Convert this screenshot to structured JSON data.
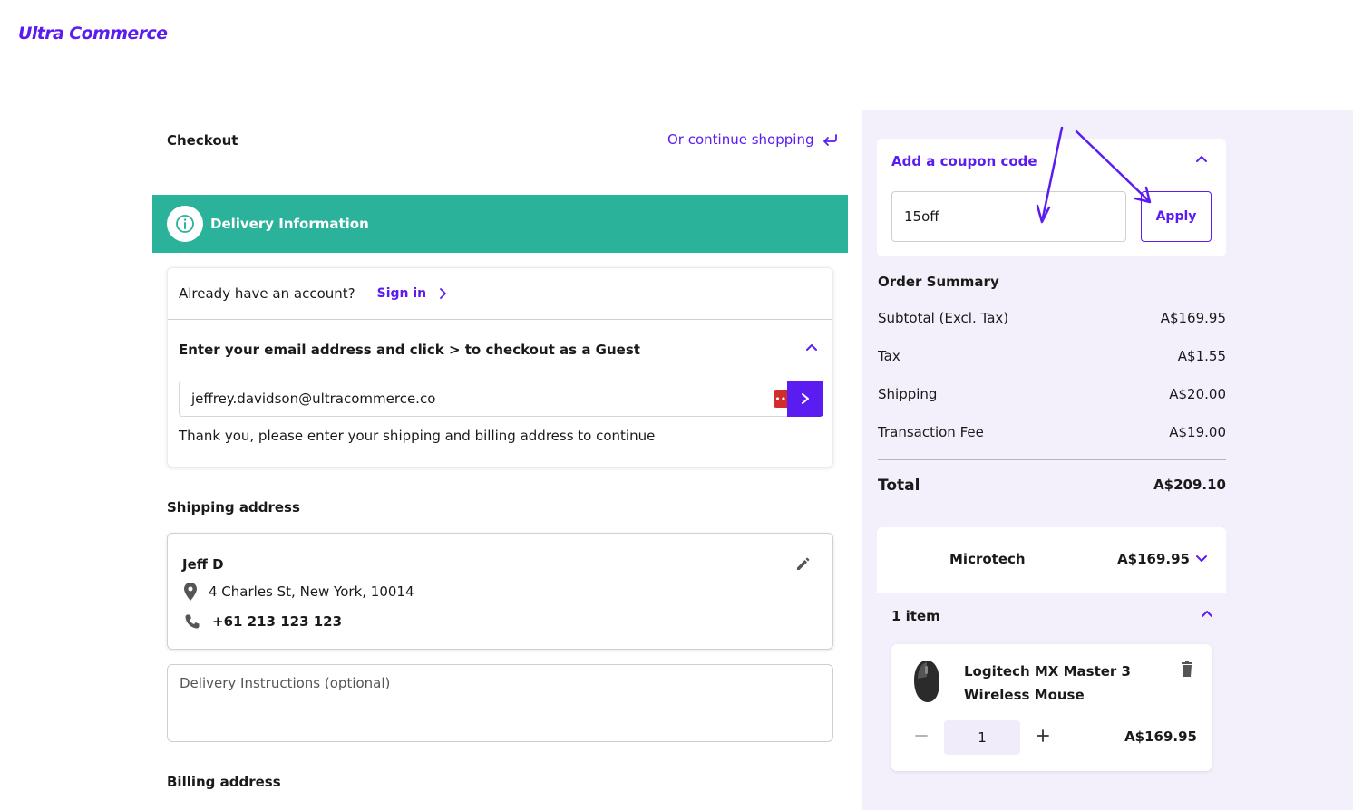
{
  "brand": {
    "logo": "Ultra Commerce",
    "accent": "#5b1cf2",
    "banner_color": "#2bb29b"
  },
  "header": {
    "title": "Checkout",
    "continue_link": "Or continue shopping"
  },
  "delivery": {
    "banner": "Delivery Information",
    "account_prompt": "Already have an account?",
    "sign_in": "Sign in",
    "guest_label": "Enter your email address and click > to checkout as a Guest",
    "email_value": "jeffrey.davidson@ultracommerce.co",
    "thanks": "Thank you, please enter your shipping and billing address to continue"
  },
  "shipping": {
    "heading": "Shipping address",
    "name": "Jeff D",
    "address": "4 Charles St, New York, 10014",
    "phone": "+61 213 123 123",
    "instructions_placeholder": "Delivery Instructions (optional)"
  },
  "billing": {
    "heading": "Billing address"
  },
  "coupon": {
    "title": "Add a coupon code",
    "value": "15off",
    "apply": "Apply"
  },
  "summary": {
    "title": "Order Summary",
    "rows": [
      {
        "label": "Subtotal (Excl. Tax)",
        "value": "A$169.95"
      },
      {
        "label": "Tax",
        "value": "A$1.55"
      },
      {
        "label": "Shipping",
        "value": "A$20.00"
      },
      {
        "label": "Transaction Fee",
        "value": "A$19.00"
      }
    ],
    "total_label": "Total",
    "total_value": "A$209.10"
  },
  "vendor": {
    "name": "Microtech",
    "price": "A$169.95",
    "items_label": "1 item",
    "item": {
      "name": "Logitech MX Master 3 Wireless Mouse",
      "qty": "1",
      "price": "A$169.95"
    }
  }
}
